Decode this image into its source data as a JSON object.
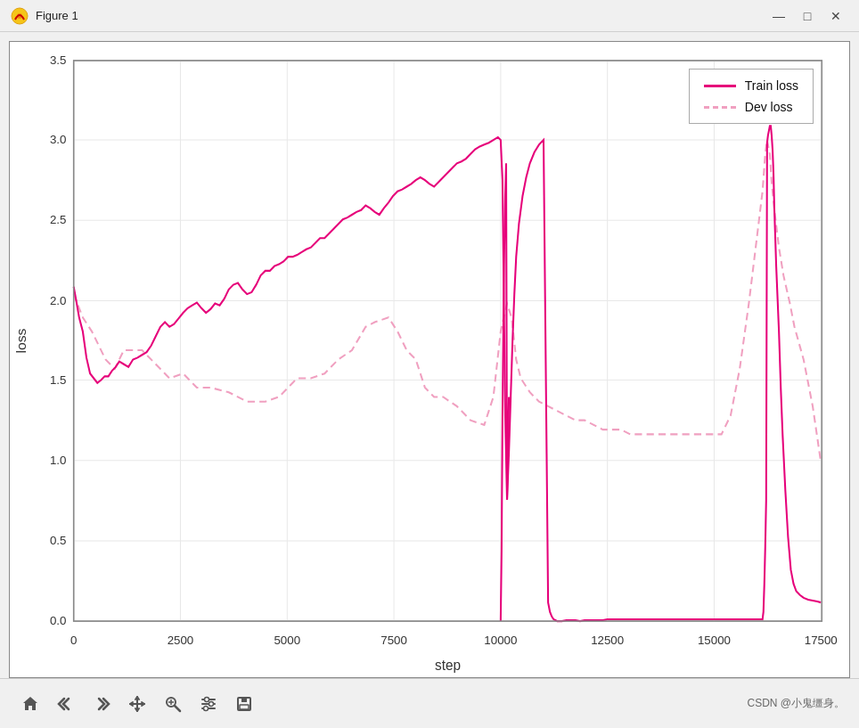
{
  "window": {
    "title": "Figure 1",
    "icon": "figure-icon"
  },
  "title_controls": {
    "minimize": "—",
    "maximize": "□",
    "close": "✕"
  },
  "chart": {
    "x_label": "step",
    "y_label": "loss",
    "x_ticks": [
      "0",
      "2500",
      "5000",
      "7500",
      "10000",
      "12500",
      "15000",
      "17500"
    ],
    "y_ticks": [
      "0.0",
      "0.5",
      "1.0",
      "1.5",
      "2.0",
      "2.5",
      "3.0",
      "3.5"
    ]
  },
  "legend": {
    "train_label": "Train loss",
    "dev_label": "Dev loss"
  },
  "toolbar": {
    "home_icon": "⌂",
    "back_icon": "←",
    "forward_icon": "→",
    "pan_icon": "✥",
    "zoom_icon": "🔍",
    "configure_icon": "≡",
    "save_icon": "💾"
  },
  "watermark": "CSDN @小鬼缰身。"
}
